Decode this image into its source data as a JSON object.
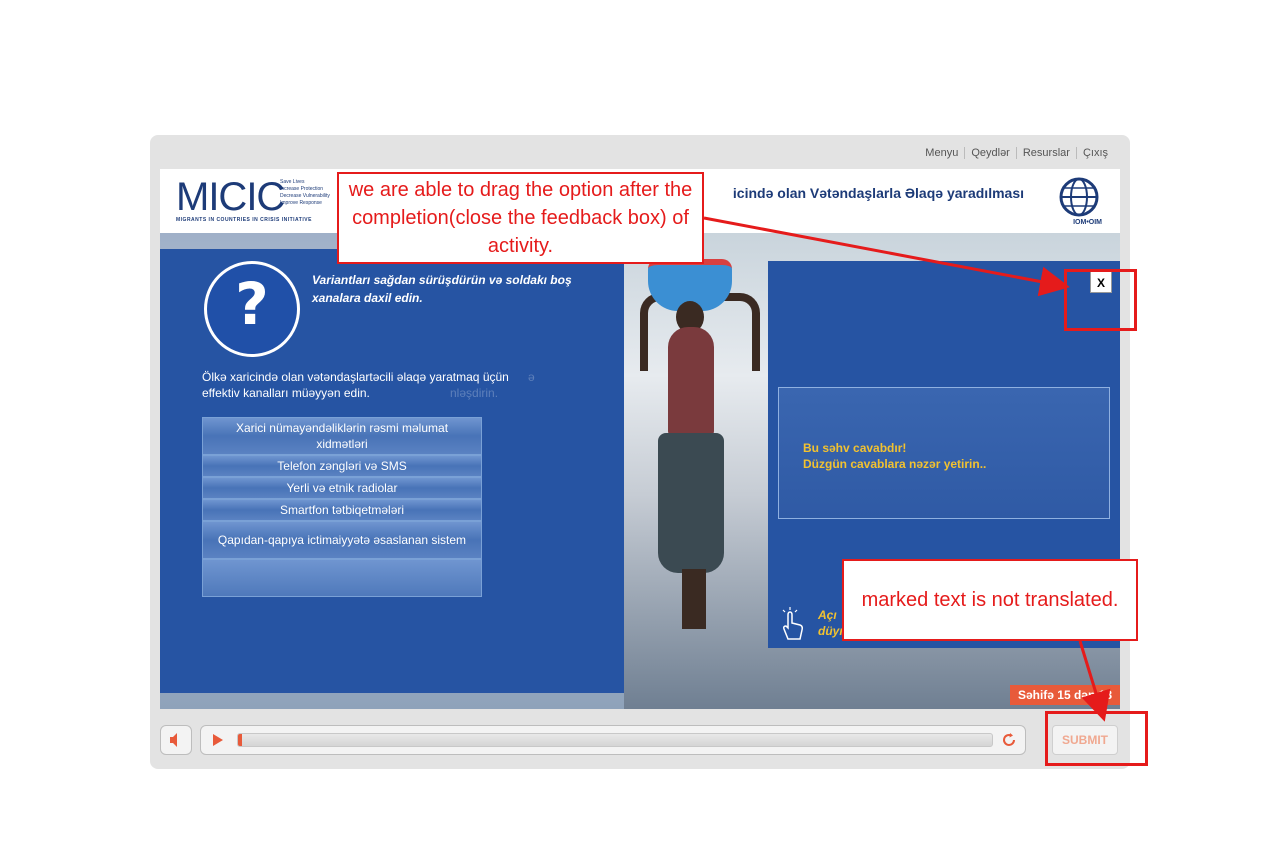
{
  "nav": {
    "menu": "Menyu",
    "notes": "Qeydlər",
    "resources": "Resurslar",
    "exit": "Çıxış"
  },
  "header": {
    "logo_text": "MICIC",
    "logo_taglines": [
      "Save Lives",
      "Increase Protection",
      "Decrease Vulnerability",
      "Improve Response"
    ],
    "logo_subtitle": "MIGRANTS IN COUNTRIES IN CRISIS INITIATIVE",
    "course_title": "icində olan Vətəndaşlarla Əlaqə yaradılması",
    "iom_label": "IOM•OIM"
  },
  "activity": {
    "instruction": "Variantları sağdan sürüşdürün və soldakı boş xanalara daxil edin.",
    "question": "Ölkə xaricində olan vətəndaşlartəcili əlaqə yaratmaq üçün effektiv kanalları müəyyən edin.",
    "ghost_text_1": "ə",
    "ghost_text_2": "nləşdirin.",
    "options": [
      "Xarici nümayəndəliklərin rəsmi məlumat xidmətləri",
      "Telefon zəngləri və SMS",
      "Yerli və etnik radiolar",
      "Smartfon tətbiqetmələri",
      "Qapıdan-qapıya ictimaiyyətə əsaslanan sistem"
    ]
  },
  "feedback": {
    "close_label": "X",
    "line1": "Bu səhv cavabdır!",
    "line2": "Düzgün cavablara nəzər yetirin..",
    "hint_line1": "Açı",
    "hint_line2": "düyməsinə klikləyin."
  },
  "page_indicator": "Səhifə 15 dən 18",
  "controls": {
    "progress": 0.005,
    "submit_label": "SUBMIT"
  },
  "annotations": {
    "drag_note": "we are able to drag the option after the completion(close the feedback box) of activity.",
    "translation_note": "marked text is not translated."
  },
  "colors": {
    "panel_blue": "#2654a3",
    "accent_orange": "#e85a3a",
    "feedback_yellow": "#f2c230",
    "annotation_red": "#e51b1b"
  }
}
